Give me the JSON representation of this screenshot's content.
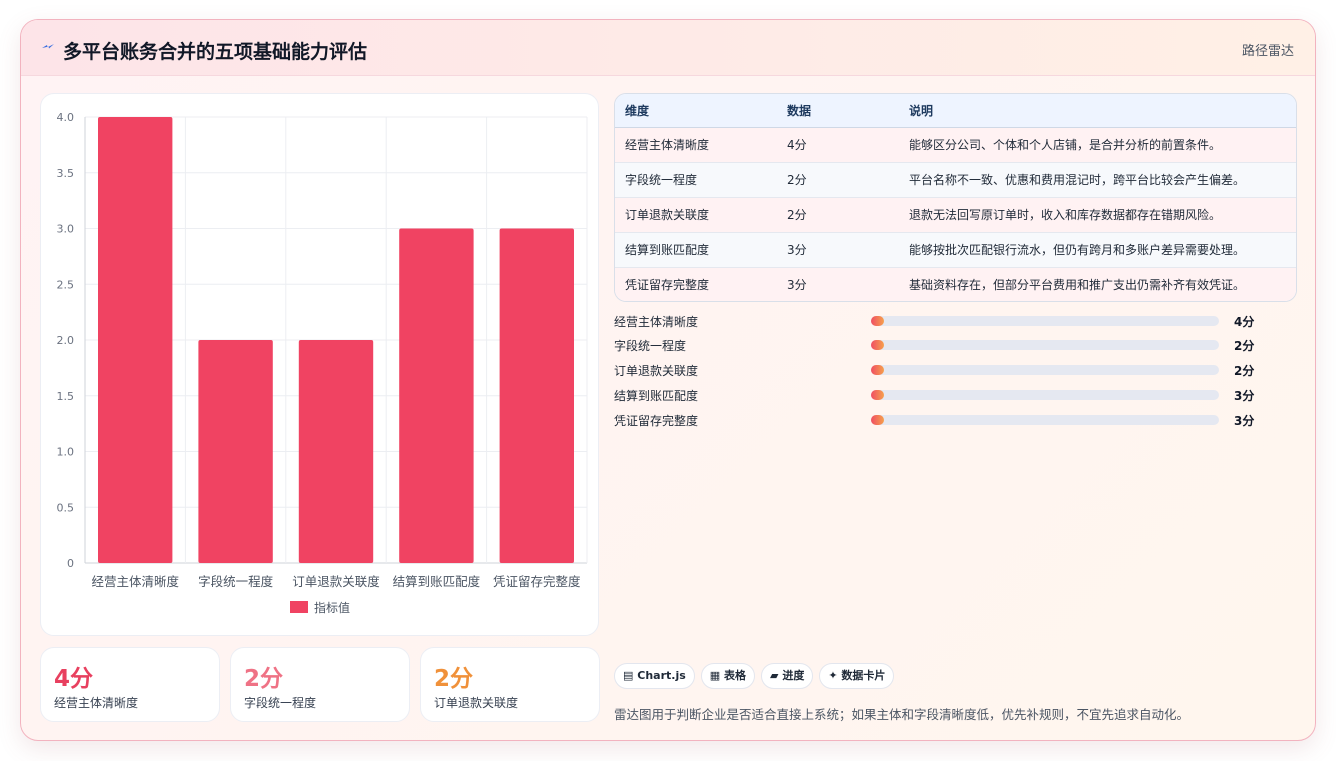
{
  "header": {
    "title": "多平台账务合并的五项基础能力评估",
    "right_label": "路径雷达",
    "icon": "lightning-icon"
  },
  "chart_data": {
    "type": "bar",
    "categories": [
      "经营主体清晰度",
      "字段统一程度",
      "订单退款关联度",
      "结算到账匹配度",
      "凭证留存完整度"
    ],
    "series": [
      {
        "name": "指标值",
        "values": [
          4,
          2,
          2,
          3,
          3
        ],
        "color": "#f04362"
      }
    ],
    "ylim": [
      0,
      4
    ],
    "yticks": [
      "0",
      "0.5",
      "1.0",
      "1.5",
      "2.0",
      "2.5",
      "3.0",
      "3.5",
      "4.0"
    ],
    "ytick_values": [
      0,
      0.5,
      1,
      1.5,
      2,
      2.5,
      3,
      3.5,
      4
    ],
    "grid": true,
    "legend": "bottom"
  },
  "stats": [
    {
      "value": "4分",
      "label": "经营主体清晰度",
      "color": "#e8405f"
    },
    {
      "value": "2分",
      "label": "字段统一程度",
      "color": "#ef7285"
    },
    {
      "value": "2分",
      "label": "订单退款关联度",
      "color": "#f0913a"
    }
  ],
  "table": {
    "headers": [
      "维度",
      "数据",
      "说明"
    ],
    "rows": [
      [
        "经营主体清晰度",
        "4分",
        "能够区分公司、个体和个人店铺，是合并分析的前置条件。"
      ],
      [
        "字段统一程度",
        "2分",
        "平台名称不一致、优惠和费用混记时，跨平台比较会产生偏差。"
      ],
      [
        "订单退款关联度",
        "2分",
        "退款无法回写原订单时，收入和库存数据都存在错期风险。"
      ],
      [
        "结算到账匹配度",
        "3分",
        "能够按批次匹配银行流水，但仍有跨月和多账户差异需要处理。"
      ],
      [
        "凭证留存完整度",
        "3分",
        "基础资料存在，但部分平台费用和推广支出仍需补齐有效凭证。"
      ]
    ]
  },
  "progress": [
    {
      "label": "经营主体清晰度",
      "value": "4分",
      "fraction": 0.0
    },
    {
      "label": "字段统一程度",
      "value": "2分",
      "fraction": 0.0
    },
    {
      "label": "订单退款关联度",
      "value": "2分",
      "fraction": 0.0
    },
    {
      "label": "结算到账匹配度",
      "value": "3分",
      "fraction": 0.0
    },
    {
      "label": "凭证留存完整度",
      "value": "3分",
      "fraction": 0.0
    }
  ],
  "chips": [
    {
      "icon": "chart-icon",
      "glyph": "▤",
      "label": "Chart.js"
    },
    {
      "icon": "table-icon",
      "glyph": "▦",
      "label": "表格"
    },
    {
      "icon": "progress-icon",
      "glyph": "▰",
      "label": "进度"
    },
    {
      "icon": "data-card-icon",
      "glyph": "✦",
      "label": "数据卡片"
    }
  ],
  "footnote": "雷达图用于判断企业是否适合直接上系统；如果主体和字段清晰度低，优先补规则，不宜先追求自动化。"
}
